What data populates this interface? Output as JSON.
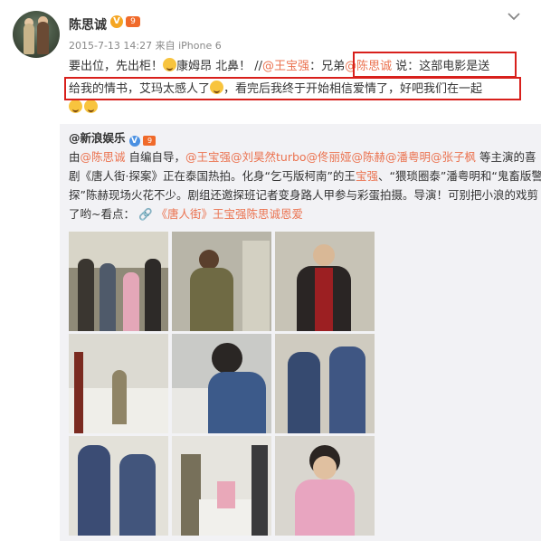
{
  "post": {
    "username": "陈思诚",
    "vip_badge": "V",
    "level_badge": "9",
    "meta": "2015-7-13 14:27 来自 iPhone 6",
    "line1_a": "要出位，先出柜！",
    "line1_b": "康姆昂 北鼻！ //",
    "line1_mention": "@王宝强",
    "line1_c": "：",
    "line1_d": "兄弟",
    "line1_mention2": "@陈思诚",
    "line1_e": " 说：这部电影是送",
    "line2_a": "给我的情书，艾玛太感人了",
    "line2_b": "，看完后我终于开始相信爱情了，好吧我们在一起"
  },
  "repost": {
    "user": "@新浪娱乐",
    "vip_badge": "V",
    "level_badge": "9",
    "l1_a": "由",
    "l1_m1": "@陈思诚",
    "l1_b": " 自编自导，",
    "l1_m2": "@王宝强@刘昊然turbo@佟丽娅@陈赫@潘粤明@张子枫",
    "l1_c": " 等主演的喜",
    "l2_a": "剧《唐人街·探案》正在泰国热拍。化身“乞丐版柯南”的王",
    "l2_m": "宝强",
    "l2_b": "、“猥琐圈泰”潘粤明和“鬼畜版警",
    "l3": "探”陈赫现场火花不少。剧组还邀探班记者变身路人甲参与彩蛋拍摄。导演！可别把小浪的戏剪",
    "l4_a": "了哟~看点：",
    "l4_link": "《唐人街》王宝强陈思诚恩爱"
  },
  "icons": [
    "chevron-down-icon",
    "smile-emoji-icon",
    "laugh-emoji-icon",
    "link-icon",
    "vip-icon",
    "level-icon"
  ],
  "colors": {
    "link": "#eb7350",
    "highlight_box": "#d8201c",
    "repost_bg": "#f2f2f5"
  }
}
